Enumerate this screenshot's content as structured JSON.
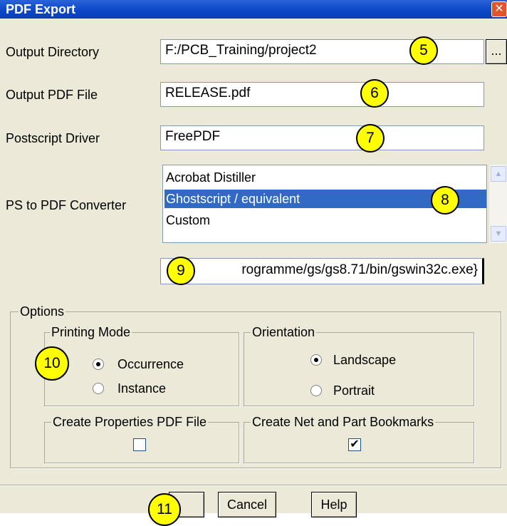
{
  "window": {
    "title": "PDF Export",
    "close_label": "✕"
  },
  "fields": {
    "output_directory": {
      "label": "Output Directory",
      "value": "F:/PCB_Training/project2",
      "browse_label": "..."
    },
    "output_pdf_file": {
      "label": "Output PDF File",
      "value": "RELEASE.pdf"
    },
    "postscript_driver": {
      "label": "Postscript Driver",
      "value": "FreePDF"
    },
    "converter": {
      "label": "PS to PDF Converter",
      "options": [
        "Acrobat Distiller",
        "Ghostscript / equivalent",
        "Custom"
      ],
      "selected": "Ghostscript / equivalent"
    },
    "command": {
      "value": "rogramme/gs/gs8.71/bin/gswin32c.exe}"
    }
  },
  "options": {
    "legend": "Options",
    "printing_mode": {
      "legend": "Printing Mode",
      "occurrence": "Occurrence",
      "instance": "Instance",
      "selected": "Occurrence"
    },
    "orientation": {
      "legend": "Orientation",
      "landscape": "Landscape",
      "portrait": "Portrait",
      "selected": "Landscape"
    },
    "create_properties": {
      "legend": "Create Properties PDF File",
      "checked": false
    },
    "bookmarks": {
      "legend": "Create Net and Part Bookmarks",
      "checked": true,
      "check_glyph": "✔"
    }
  },
  "buttons": {
    "cancel": "Cancel",
    "help": "Help"
  },
  "callouts": [
    "5",
    "6",
    "7",
    "8",
    "9",
    "10",
    "11"
  ]
}
